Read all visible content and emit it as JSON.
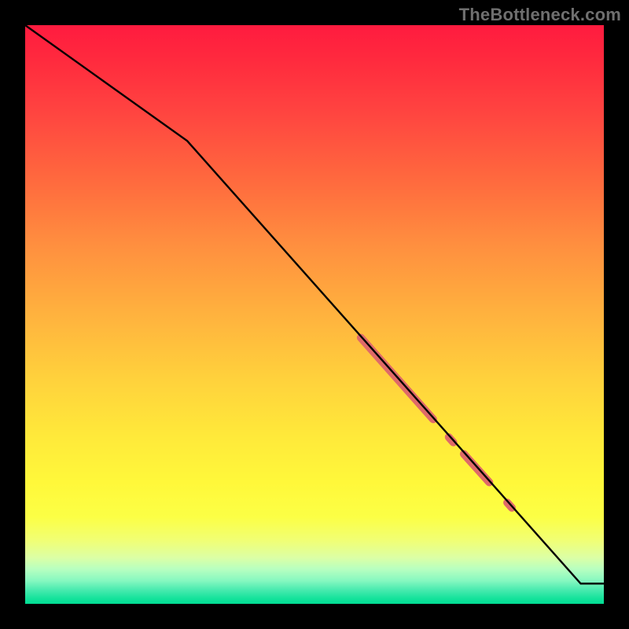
{
  "watermark": "TheBottleneck.com",
  "chart_data": {
    "type": "line",
    "title": "",
    "xlabel": "",
    "ylabel": "",
    "xlim": [
      0,
      100
    ],
    "ylim": [
      0,
      100
    ],
    "grid": false,
    "series": [
      {
        "name": "curve",
        "x": [
          0,
          28,
          96,
          100
        ],
        "y": [
          100,
          80,
          3.5,
          3.5
        ],
        "stroke": "#000000",
        "width": 2.4
      }
    ],
    "highlights": [
      {
        "name": "seg-a",
        "x0": 58,
        "y0": 46.0,
        "x1": 70.5,
        "y1": 31.9,
        "color": "#df6a69",
        "width": 10
      },
      {
        "name": "dot-b",
        "x0": 73.2,
        "y0": 28.8,
        "x1": 74.0,
        "y1": 27.9,
        "color": "#df6a69",
        "width": 10
      },
      {
        "name": "seg-c",
        "x0": 75.8,
        "y0": 25.9,
        "x1": 80.2,
        "y1": 21.0,
        "color": "#df6a69",
        "width": 10
      },
      {
        "name": "dot-d",
        "x0": 83.3,
        "y0": 17.5,
        "x1": 84.1,
        "y1": 16.6,
        "color": "#df6a69",
        "width": 10
      }
    ]
  }
}
